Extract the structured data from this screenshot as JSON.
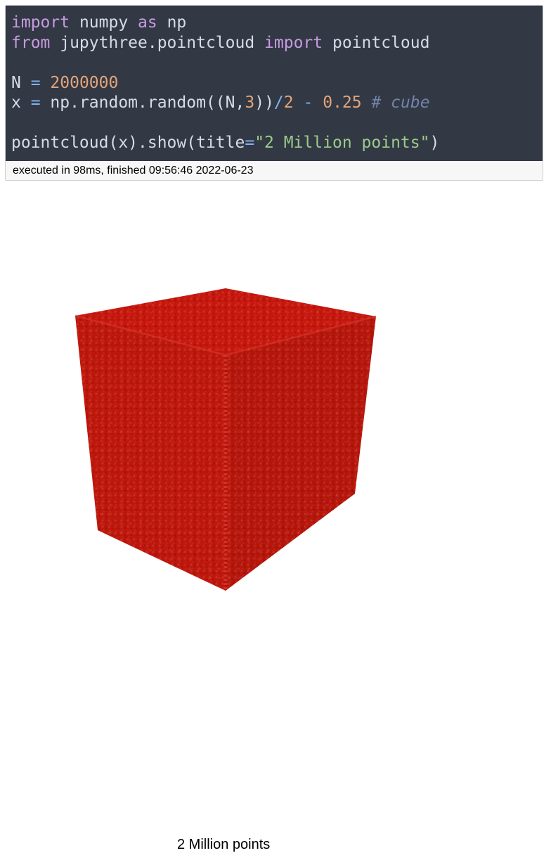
{
  "code_cell": {
    "lines": [
      [
        {
          "t": "import",
          "c": "kw"
        },
        {
          "t": " numpy ",
          "c": ""
        },
        {
          "t": "as",
          "c": "kw"
        },
        {
          "t": " np",
          "c": ""
        }
      ],
      [
        {
          "t": "from",
          "c": "kw"
        },
        {
          "t": " jupythree.pointcloud ",
          "c": ""
        },
        {
          "t": "import",
          "c": "kw"
        },
        {
          "t": " pointcloud",
          "c": ""
        }
      ],
      [],
      [
        {
          "t": "N ",
          "c": ""
        },
        {
          "t": "=",
          "c": "op"
        },
        {
          "t": " ",
          "c": ""
        },
        {
          "t": "2000000",
          "c": "num"
        }
      ],
      [
        {
          "t": "x ",
          "c": ""
        },
        {
          "t": "=",
          "c": "op"
        },
        {
          "t": " np.random.random((N,",
          "c": ""
        },
        {
          "t": "3",
          "c": "num"
        },
        {
          "t": "))",
          "c": ""
        },
        {
          "t": "/",
          "c": "op"
        },
        {
          "t": "2",
          "c": "num"
        },
        {
          "t": " ",
          "c": ""
        },
        {
          "t": "-",
          "c": "op"
        },
        {
          "t": " ",
          "c": ""
        },
        {
          "t": "0.25",
          "c": "num"
        },
        {
          "t": " ",
          "c": ""
        },
        {
          "t": "# cube",
          "c": "cmt"
        }
      ],
      [],
      [
        {
          "t": "pointcloud(x).show(title",
          "c": ""
        },
        {
          "t": "=",
          "c": "op"
        },
        {
          "t": "\"2 Million points\"",
          "c": "str"
        },
        {
          "t": ")",
          "c": ""
        }
      ]
    ],
    "status_text": "executed in 98ms, finished 09:56:46 2022-06-23"
  },
  "viewer": {
    "title": "2 Million points",
    "point_color": "#c0170c"
  },
  "theme": {
    "code_bg": "#323844",
    "code_text": "#d6dce6",
    "keyword": "#c79ae0",
    "operator": "#80b4ee",
    "number": "#e4a57a",
    "string": "#9ccb8c",
    "comment": "#7283ab"
  }
}
